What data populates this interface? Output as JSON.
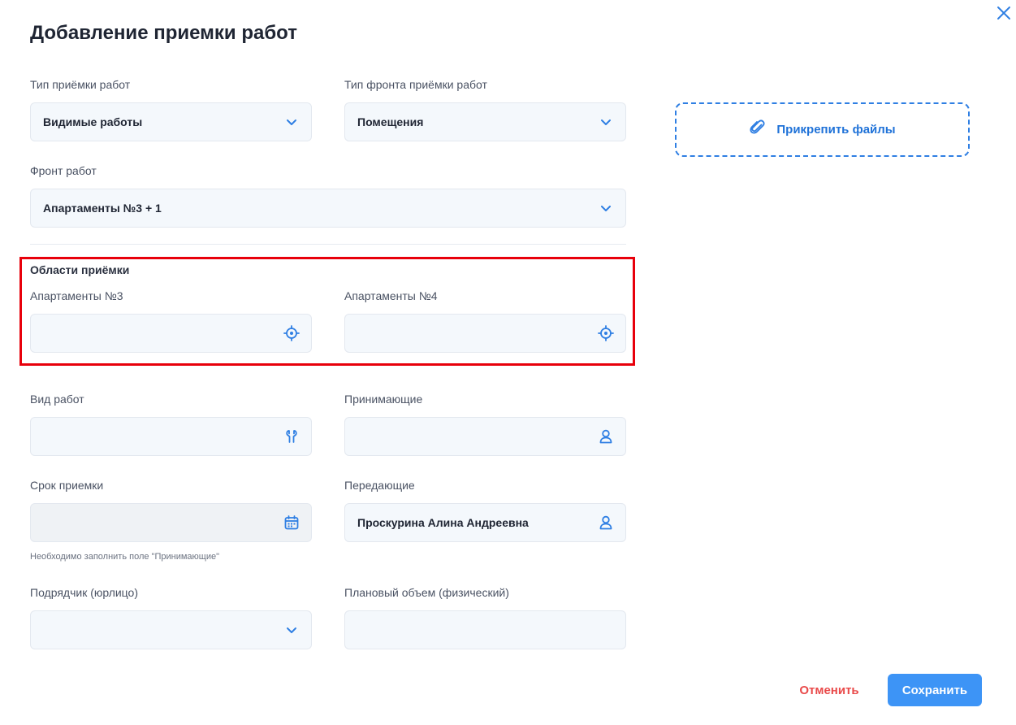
{
  "dialog": {
    "title": "Добавление приемки работ"
  },
  "form": {
    "acceptance_type": {
      "label": "Тип приёмки работ",
      "value": "Видимые работы"
    },
    "front_type": {
      "label": "Тип фронта приёмки работ",
      "value": "Помещения"
    },
    "work_front": {
      "label": "Фронт работ",
      "value": "Апартаменты №3 + 1"
    },
    "areas": {
      "title": "Области приёмки",
      "area1": {
        "label": "Апартаменты №3",
        "value": ""
      },
      "area2": {
        "label": "Апартаменты №4",
        "value": ""
      }
    },
    "work_kind": {
      "label": "Вид работ",
      "value": ""
    },
    "receivers": {
      "label": "Принимающие",
      "value": ""
    },
    "deadline": {
      "label": "Срок приемки",
      "value": "",
      "hint": "Необходимо заполнить поле \"Принимающие\""
    },
    "transmitters": {
      "label": "Передающие",
      "value": "Проскурина Алина Андреевна"
    },
    "contractor": {
      "label": "Подрядчик (юрлицо)",
      "value": ""
    },
    "planned_volume": {
      "label": "Плановый объем (физический)",
      "value": ""
    }
  },
  "attach": {
    "label": "Прикрепить файлы"
  },
  "actions": {
    "cancel": "Отменить",
    "save": "Сохранить"
  },
  "colors": {
    "accent": "#3d94f6",
    "icon": "#2f7fe3",
    "danger": "#e94a4a",
    "highlight": "#e8000b"
  }
}
